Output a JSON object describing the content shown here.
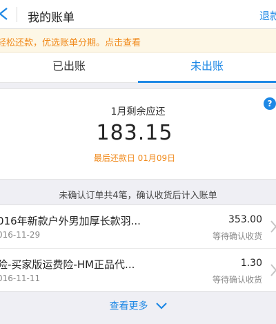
{
  "header": {
    "title": "我的账单",
    "action_label": "退款"
  },
  "promo": {
    "text": "轻松还款，优选账单分期。点击查看"
  },
  "tabs": [
    {
      "label": "已出账"
    },
    {
      "label": "未出账",
      "active": true
    }
  ],
  "summary": {
    "month_label": "1月剩余应还",
    "amount": "183.15",
    "due_date": "最后还款日 01月09日",
    "help_label": "?"
  },
  "unconfirmed_note": "未确认订单共4笔，确认收货后计入账单",
  "orders": [
    {
      "title": "016年新款户外男加厚长款羽...",
      "date": "016-11-29",
      "amount": "353.00",
      "status": "等待确认收货"
    },
    {
      "title": "险-买家版运费险-HM正品代...",
      "date": "016-11-11",
      "amount": "1.30",
      "status": "等待确认收货"
    }
  ],
  "more": {
    "label": "查看更多"
  },
  "colors": {
    "accent": "#1e88e5",
    "warning": "#f08a1c"
  }
}
